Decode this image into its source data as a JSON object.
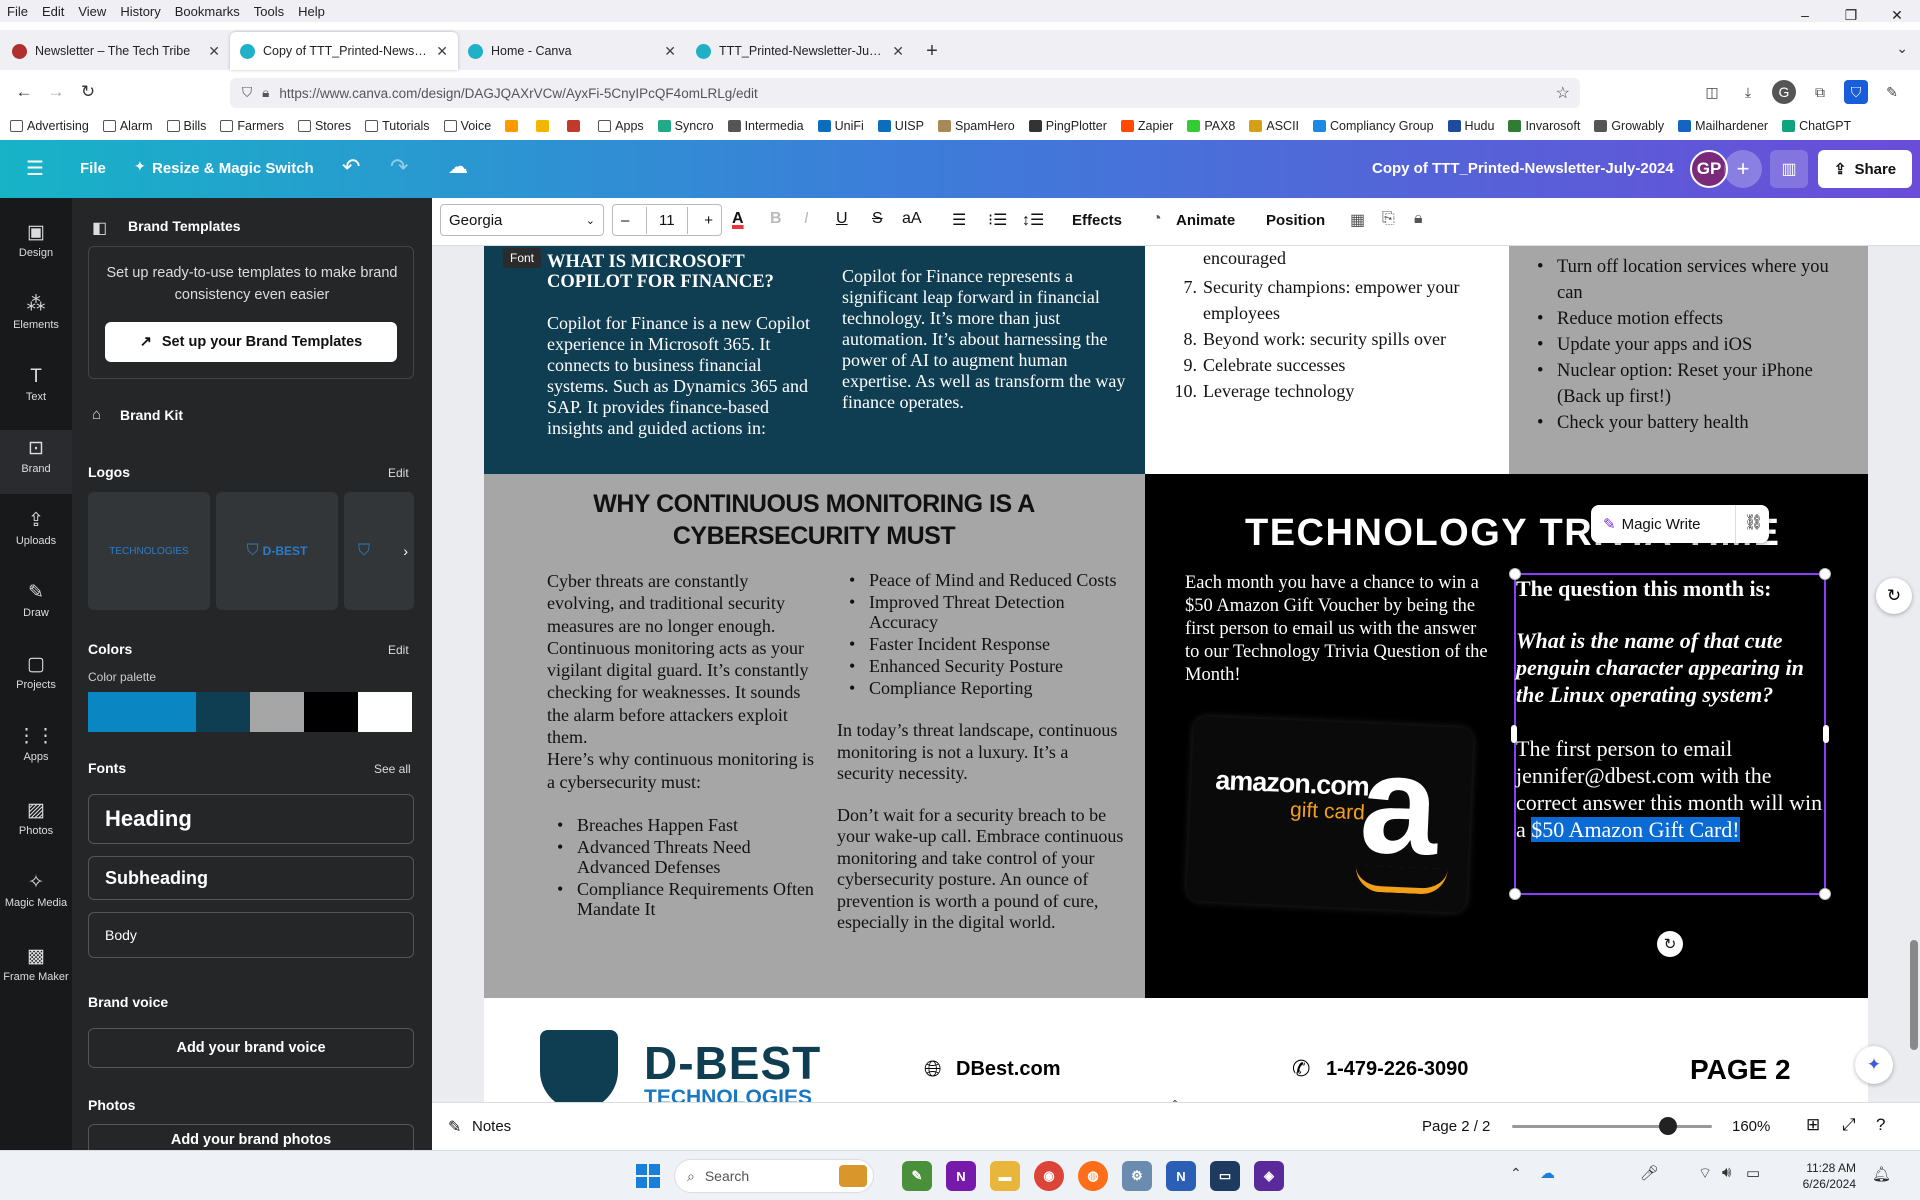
{
  "menubar": [
    "File",
    "Edit",
    "View",
    "History",
    "Bookmarks",
    "Tools",
    "Help"
  ],
  "window_controls": [
    "–",
    "❐",
    "✕"
  ],
  "tabs": [
    {
      "title": "Newsletter – The Tech Tribe",
      "fav": "#b03030"
    },
    {
      "title": "Copy of TTT_Printed-Newsletter-July-2024",
      "fav": "#20b0c8"
    },
    {
      "title": "Home - Canva",
      "fav": "#20b0c8"
    },
    {
      "title": "TTT_Printed-Newsletter-July-2024",
      "fav": "#20b0c8"
    }
  ],
  "url": "https://www.canva.com/design/DAGJQAXrVCw/AyxFi-5CnyIPcQF4omLRLg/edit",
  "bookmarks": [
    "Advertising",
    "Alarm",
    "Bills",
    "Farmers",
    "Stores",
    "Tutorials",
    "Voice",
    "",
    "",
    "",
    "Apps",
    "Syncro",
    "Intermedia",
    "UniFi",
    "UISP",
    "SpamHero",
    "PingPlotter",
    "Zapier",
    "PAX8",
    "ASCII",
    "Compliancy Group",
    "Hudu",
    "Invarosoft",
    "Growably",
    "Mailhardener",
    "ChatGPT"
  ],
  "canva_header": {
    "menu_icon": "☰",
    "file": "File",
    "resize": "Resize & Magic Switch",
    "doc_title": "Copy of  TTT_Printed-Newsletter-July-2024",
    "avatar": "GP",
    "share": "Share"
  },
  "rail": [
    "Design",
    "Elements",
    "Text",
    "Brand",
    "Uploads",
    "Draw",
    "Projects",
    "Apps",
    "Photos",
    "Magic Media",
    "Frame Maker"
  ],
  "panel": {
    "title": "Brand Templates",
    "brand_templates_text": "Set up ready-to-use templates to make brand consistency even easier",
    "setup_button": "Set up your Brand Templates",
    "brand_kit": "Brand Kit",
    "logos": "Logos",
    "logos_edit": "Edit",
    "logo_label": "TECHNOLOGIES",
    "logo_label_2": "D-BEST",
    "colors": "Colors",
    "colors_edit": "Edit",
    "color_palette": "Color palette",
    "palette": [
      "#0a86c2",
      "#0a86c2",
      "#0f3d52",
      "#a6a6a6",
      "#000000",
      "#ffffff"
    ],
    "fonts": "Fonts",
    "see_all": "See all",
    "font_heading": "Heading",
    "font_subheading": "Subheading",
    "font_body": "Body",
    "brand_voice": "Brand voice",
    "add_brand_voice": "Add your brand voice",
    "photos": "Photos",
    "add_brand_photos": "Add your brand photos"
  },
  "toolbar": {
    "font": "Georgia",
    "size": "11",
    "effects": "Effects",
    "animate": "Animate",
    "position": "Position",
    "font_tooltip": "Font"
  },
  "newsletter": {
    "copilot_heading": "WHAT IS MICROSOFT COPILOT FOR FINANCE?",
    "copilot_left": "Copilot for Finance is a new Copilot experience in Microsoft 365. It connects to business financial systems. Such as Dynamics 365 and SAP. It provides finance-based insights and guided actions in:",
    "copilot_right": "Copilot for Finance represents a significant leap forward in financial technology. It’s more than just automation. It’s about harnessing the power of AI to augment human expertise. As well as transform the way finance operates.",
    "tips_partial": "encouraged",
    "tips": [
      {
        "n": "7.",
        "t": "Security champions: empower your employees"
      },
      {
        "n": "8.",
        "t": "Beyond work: security spills over"
      },
      {
        "n": "9.",
        "t": "Celebrate successes"
      },
      {
        "n": "10.",
        "t": "Leverage technology"
      }
    ],
    "iphone": [
      "Turn off location services where you can",
      "Reduce motion effects",
      "Update your apps and iOS",
      "Nuclear option: Reset your iPhone (Back up first!)",
      "Check your battery health"
    ],
    "monitor_heading": "WHY CONTINUOUS MONITORING IS A CYBERSECURITY MUST",
    "monitor_left": "Cyber threats are constantly evolving, and traditional security measures are no longer enough. Continuous monitoring acts as your vigilant digital guard. It’s constantly checking for weaknesses. It sounds the alarm before attackers exploit them.",
    "monitor_left2": "Here’s why continuous monitoring is a cybersecurity must:",
    "monitor_bullets": [
      "Breaches Happen Fast",
      "Advanced Threats Need Advanced Defenses",
      "Compliance Requirements Often Mandate It"
    ],
    "monitor_right_bullets": [
      "Peace of Mind and Reduced Costs",
      "Improved Threat Detection Accuracy",
      "Faster Incident Response",
      "Enhanced Security Posture",
      "Compliance Reporting"
    ],
    "monitor_right1": "In today’s threat landscape, continuous monitoring is not a luxury. It’s a security necessity.",
    "monitor_right2": "Don’t wait for a security breach to be your wake-up call. Embrace continuous monitoring and take control of your cybersecurity posture. An ounce of prevention is worth a pound of cure, especially in the digital world.",
    "trivia_heading": "TECHNOLOGY TRIVIA TIME",
    "trivia_text": "Each month you have a chance to win a $50 Amazon Gift Voucher by being the first person to email us with the answer to our Technology Trivia Question of the Month!",
    "question_label": "The question this month is:",
    "question": "What is the name of that cute penguin character appearing in the Linux operating system?",
    "answer_text": "The first person to email jennifer@dbest.com with the correct answer this month will win a ",
    "answer_highlight": "$50 Amazon Gift Card!",
    "magic_write": "Magic Write",
    "amazon_logo": "amazon.com",
    "amazon_sub": "gift card",
    "footer_logo": "D-BEST",
    "footer_logo_sub": "TECHNOLOGIES",
    "footer_web": "DBest.com",
    "footer_phone": "1-479-226-3090",
    "footer_page": "PAGE 2"
  },
  "statusbar": {
    "notes": "Notes",
    "page": "Page 2 / 2",
    "zoom": "160%",
    "zoom_level": 0.78
  },
  "taskbar": {
    "search": "Search",
    "time": "11:28 AM",
    "date": "6/26/2024"
  }
}
